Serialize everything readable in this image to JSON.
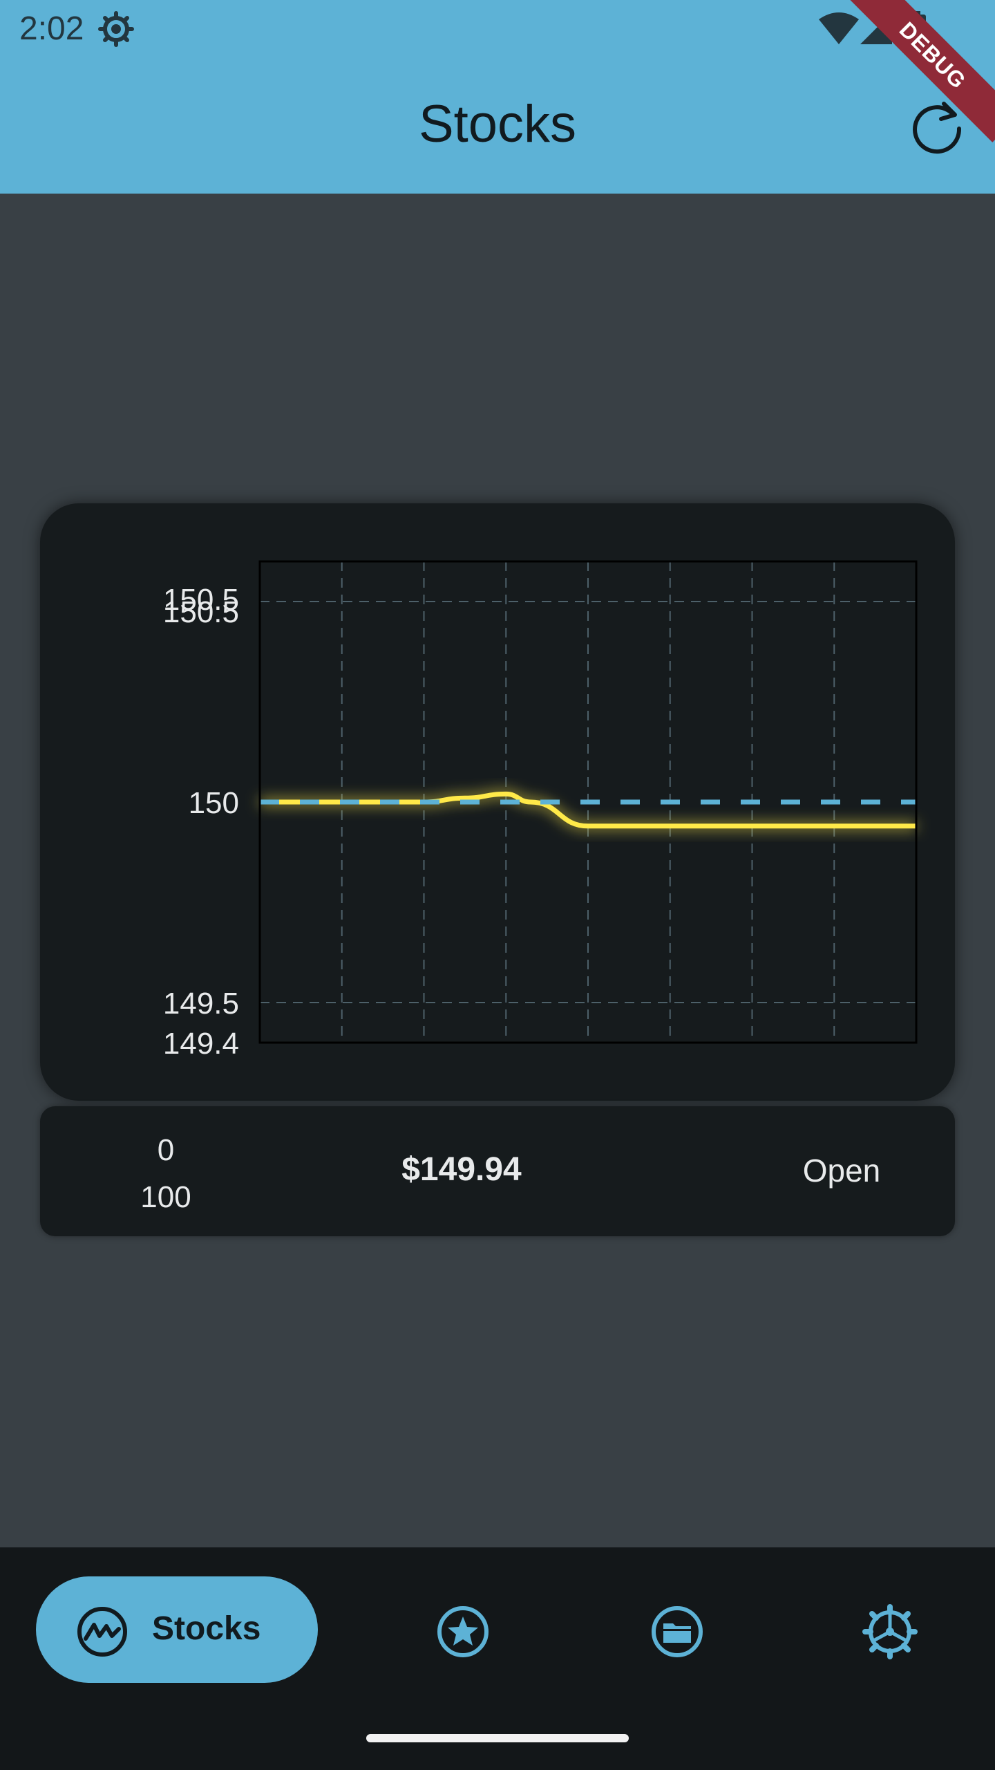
{
  "status_bar": {
    "time": "2:02",
    "icons": [
      "gear-icon",
      "wifi-icon",
      "signal-icon",
      "battery-icon"
    ]
  },
  "debug_banner": "DEBUG",
  "header": {
    "title": "Stocks",
    "refresh_icon": "refresh-icon"
  },
  "chart_data": {
    "type": "line",
    "ylim": [
      149.4,
      150.6
    ],
    "y_ticks": [
      "150.5",
      "150.5",
      "150",
      "149.5",
      "149.4"
    ],
    "y_tick_values": [
      150.5,
      150.5,
      150,
      149.5,
      149.4
    ],
    "grid": true,
    "series": [
      {
        "color": "#ffe94a",
        "x": [
          0,
          1,
          2,
          2.5,
          3,
          3.3,
          4,
          5,
          6,
          7,
          8
        ],
        "y": [
          150,
          150,
          150,
          150.01,
          150.02,
          150.0,
          149.94,
          149.94,
          149.94,
          149.94,
          149.94
        ]
      },
      {
        "color": "#5db2d6",
        "dashed": true,
        "x": [
          0,
          8
        ],
        "y": [
          150,
          150
        ]
      }
    ],
    "xlim": [
      0,
      8
    ]
  },
  "info_card": {
    "low_value": "0",
    "high_value": "100",
    "price": "$149.94",
    "status": "Open"
  },
  "bottom_nav": {
    "items": [
      {
        "label": "Stocks",
        "icon": "stock-chart-icon",
        "active": true
      },
      {
        "label": "",
        "icon": "star-icon",
        "active": false
      },
      {
        "label": "",
        "icon": "folder-icon",
        "active": false
      },
      {
        "label": "",
        "icon": "settings-icon",
        "active": false
      }
    ]
  },
  "colors": {
    "accent": "#5db2d6",
    "line": "#ffe94a",
    "background": "#394045",
    "card": "#161b1d"
  }
}
